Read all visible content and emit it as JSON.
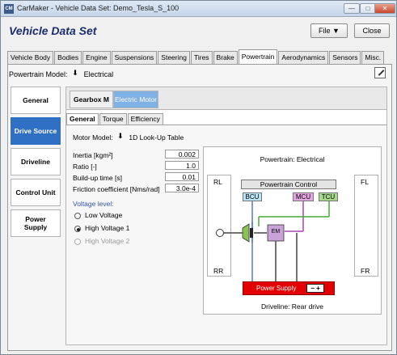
{
  "window": {
    "app_icon": "CM",
    "title": "CarMaker - Vehicle Data Set: Demo_Tesla_S_100",
    "controls": [
      "minimize-icon",
      "maximize-icon",
      "close-icon"
    ]
  },
  "header": {
    "page_title": "Vehicle Data Set",
    "file_label": "File ▼",
    "close_label": "Close"
  },
  "tabs": [
    "Vehicle Body",
    "Bodies",
    "Engine",
    "Suspensions",
    "Steering",
    "Tires",
    "Brake",
    "Powertrain",
    "Aerodynamics",
    "Sensors",
    "Misc."
  ],
  "active_tab": "Powertrain",
  "powertrain_model": {
    "label": "Powertrain Model:",
    "value": "Electrical"
  },
  "sidebar": {
    "items": [
      "General",
      "Drive Source",
      "Driveline",
      "Control Unit",
      "Power Supply"
    ],
    "active": "Drive Source"
  },
  "subtabs": {
    "gearbox": "Gearbox M",
    "motor": "Electric Motor"
  },
  "inner_tabs": [
    "General",
    "Torque",
    "Efficiency"
  ],
  "motor_model": {
    "label": "Motor Model:",
    "value": "1D Look-Up Table"
  },
  "params": [
    {
      "label": "Inertia [kgm²]",
      "value": "0.002"
    },
    {
      "label": "Ratio [-]",
      "value": "1.0"
    },
    {
      "label": "Build-up time [s]",
      "value": "0.01"
    },
    {
      "label": "Friction coefficient [Nms/rad]",
      "value": "3.0e-4"
    }
  ],
  "voltage": {
    "label": "Voltage level:",
    "options": [
      "Low Voltage",
      "High Voltage 1",
      "High Voltage 2"
    ],
    "selected": "High Voltage 1",
    "disabled": "High Voltage 2"
  },
  "diagram": {
    "title": "Powertrain: Electrical",
    "corners": {
      "rl": "RL",
      "fl": "FL",
      "rr": "RR",
      "fr": "FR"
    },
    "control_label": "Powertrain Control",
    "units": {
      "bcu": "BCU",
      "mcu": "MCU",
      "tcu": "TCU"
    },
    "motor_label": "EM",
    "power_supply_label": "Power Supply",
    "battery_label": "− +",
    "driveline_caption": "Driveline: Rear drive",
    "colors": {
      "bcu": "#b9e3f5",
      "mcu": "#e3a6e0",
      "tcu": "#a8d98b",
      "power": "#e20000",
      "motor_green": "#8cc152",
      "motor_purple": "#c9a3d8"
    }
  }
}
